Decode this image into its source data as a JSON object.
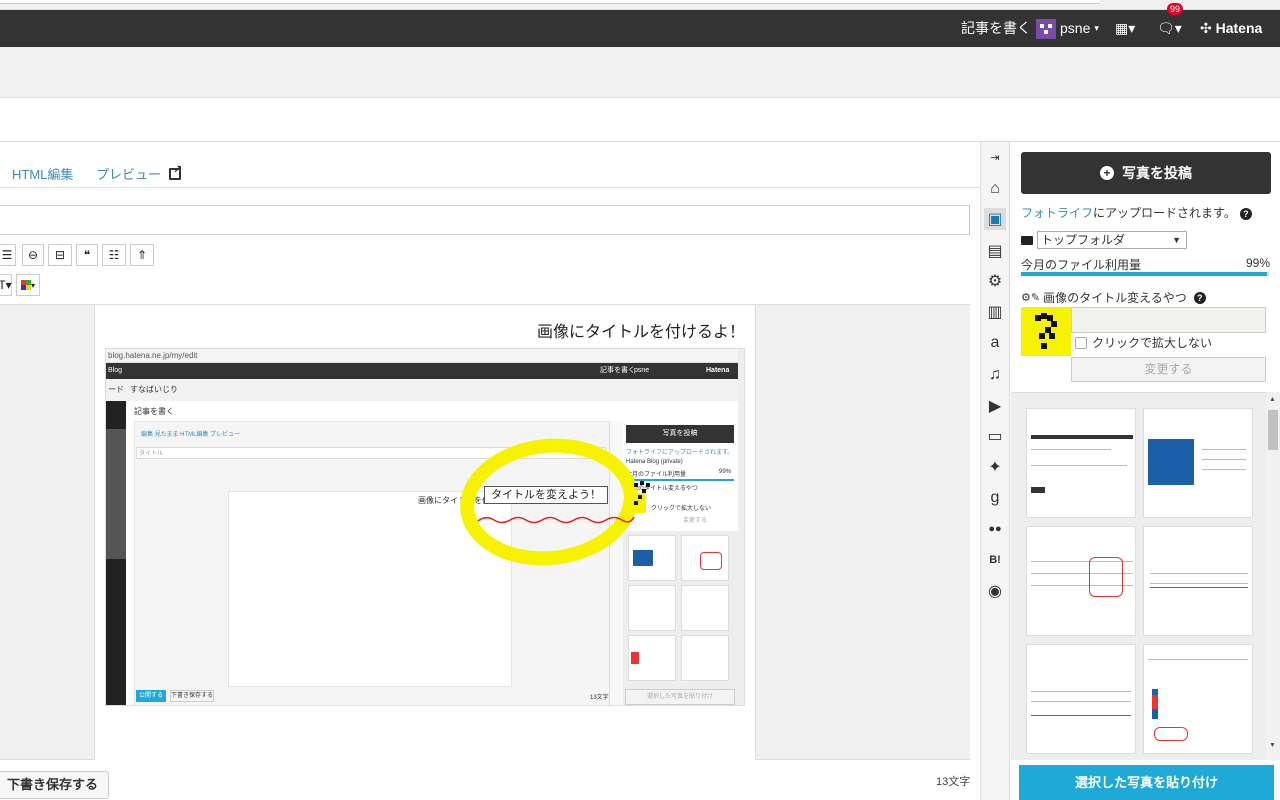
{
  "globalnav": {
    "write_label": "記事を書く",
    "user_name": "psne",
    "user_caret": "▾",
    "apps_glyph": "▦▾",
    "notif_count": "99",
    "logo": "Hatena"
  },
  "tabs": {
    "html_label": "HTML編集",
    "preview_label": "プレビュー"
  },
  "toolbar": {
    "list_glyph": "☰",
    "link_glyph": "⊖",
    "hr_glyph": "⊟",
    "quote_glyph": "❝",
    "more_glyph": "☷",
    "upload_glyph": "⇑",
    "font_glyph": "T▾",
    "color_caret": "▾"
  },
  "editor": {
    "body_text": "画像にタイトルを付けるよ！",
    "char_count": "13文字",
    "draft_label": "下書き保存する"
  },
  "screenshot": {
    "url": "blog.hatena.ne.jp/my/edit",
    "nav_left": "Blog",
    "nav_write": "記事を書く",
    "nav_user": "psne",
    "nav_logo": "Hatena",
    "band_left": "ード",
    "band_blog": "すなばいじり",
    "heading": "記事を書く",
    "tabs_text": "編集 見たまま   HTML編集   プレビュー",
    "title_placeholder": "タイトル",
    "page_text": "画像にタイトルを付",
    "callout": "タイトルを変えよう！",
    "publish": "公開する",
    "draft": "下書き保存する",
    "count": "13文字",
    "post_btn": "写真を投稿",
    "fotolife": "フォトライフにアップロードされます。",
    "folder": "Hatena Blog (private)",
    "usage": "今月のファイル利用量",
    "usage_pct": "99%",
    "plugin": "画像のタイトル変えるやつ",
    "noexpand": "クリックで拡大しない",
    "change": "変更する",
    "paste": "選択した写真を貼り付け"
  },
  "iconbar": {
    "collapse": "⇥",
    "icons": [
      "home-icon",
      "photo-icon",
      "category-icon",
      "gear-icon",
      "document-icon",
      "amazon-icon",
      "music-icon",
      "youtube-icon",
      "tv-icon",
      "twitter-icon",
      "google-icon",
      "flickr-icon",
      "hatena-bookmark-icon",
      "github-icon"
    ],
    "glyphs": [
      "⌂",
      "▣",
      "▤",
      "⚙",
      "▥",
      "a",
      "♫",
      "▶",
      "▭",
      "✦",
      "g",
      "●●",
      "B!",
      "◉"
    ]
  },
  "panel": {
    "post_button": "写真を投稿",
    "fotolife_link": "フォトライフ",
    "fotolife_rest": "にアップロードされます。",
    "folder": "トップフォルダ",
    "folder_caret": "▼",
    "usage_label": "今月のファイル利用量",
    "usage_pct": "99%",
    "usage_fraction": 0.99,
    "plugin_title": "画像のタイトル変えるやつ",
    "title_input_value": "",
    "noexpand_label": "クリックで拡大しない",
    "change_button": "変更する",
    "paste_button": "選択した写真を貼り付け",
    "help_glyph": "?"
  },
  "colors": {
    "accent": "#1fa9d6",
    "nav_bg": "#333333",
    "link": "#3b8bbf",
    "highlight": "#f7f200"
  }
}
